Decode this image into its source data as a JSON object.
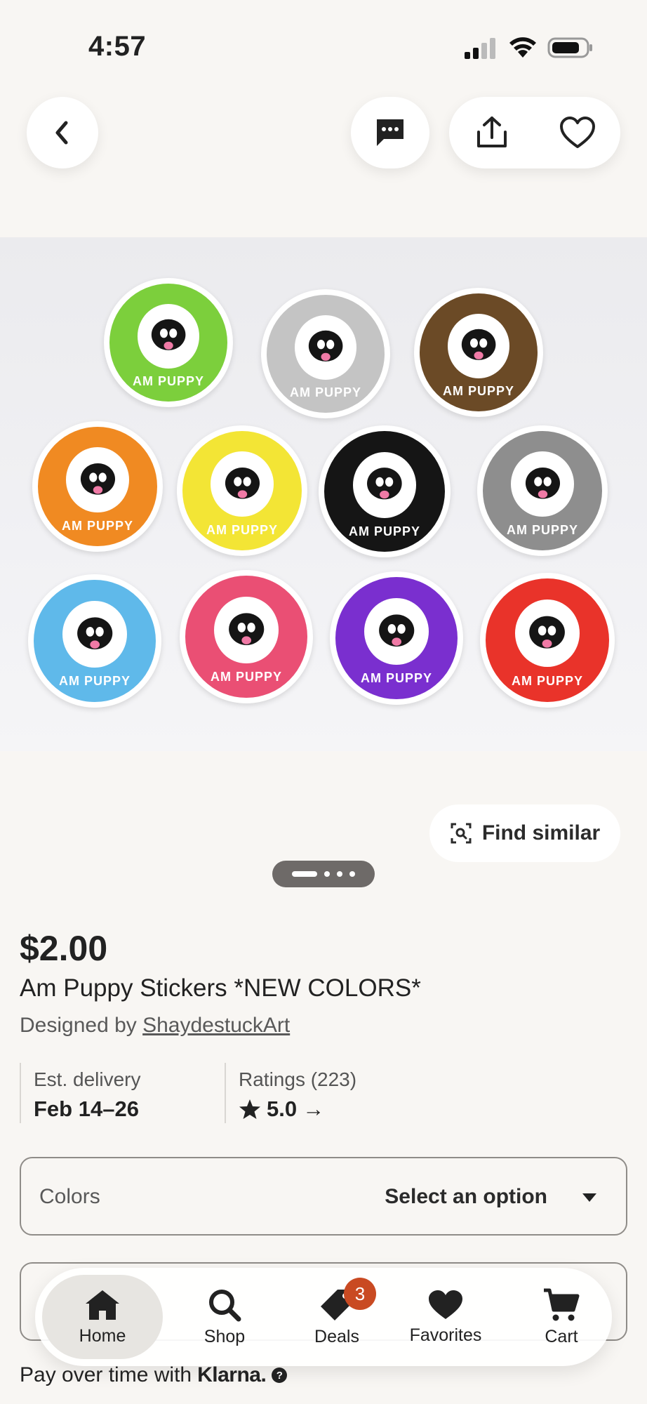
{
  "status_bar": {
    "time": "4:57"
  },
  "header": {
    "back_icon": "chevron-left-icon",
    "message_icon": "message-icon",
    "share_icon": "share-icon",
    "favorite_icon": "heart-outline-icon"
  },
  "hero": {
    "sticker_text": "AM PUPPY",
    "sticker_colors": [
      "#7ccf3c",
      "#c4c4c4",
      "#6b4a26",
      "#f08a22",
      "#f3e535",
      "#151515",
      "#8e8e8e",
      "#5fb9ea",
      "#ea4f74",
      "#7a2fcf",
      "#e9332a"
    ]
  },
  "find_similar": {
    "label": "Find similar",
    "icon": "image-search-icon"
  },
  "carousel": {
    "pages": 4,
    "current": 1
  },
  "product": {
    "price": "$2.00",
    "title": "Am Puppy Stickers *NEW COLORS*",
    "designed_prefix": "Designed by ",
    "shop_name": "ShaydestuckArt"
  },
  "info": {
    "delivery_label": "Est. delivery",
    "delivery_value": "Feb 14–26",
    "ratings_label": "Ratings (223)",
    "ratings_value": "5.0",
    "ratings_arrow": "→"
  },
  "options": {
    "label": "Colors",
    "value": "Select an option"
  },
  "tab_bar": {
    "home": "Home",
    "shop": "Shop",
    "deals": "Deals",
    "deals_badge": "3",
    "favorites": "Favorites",
    "cart": "Cart"
  },
  "klarna": {
    "text": "Pay over time with",
    "brand": "Klarna.",
    "help": "?"
  },
  "colors": {
    "accent_badge": "#c94a22",
    "text_primary": "#222222",
    "background": "#f8f6f3"
  }
}
